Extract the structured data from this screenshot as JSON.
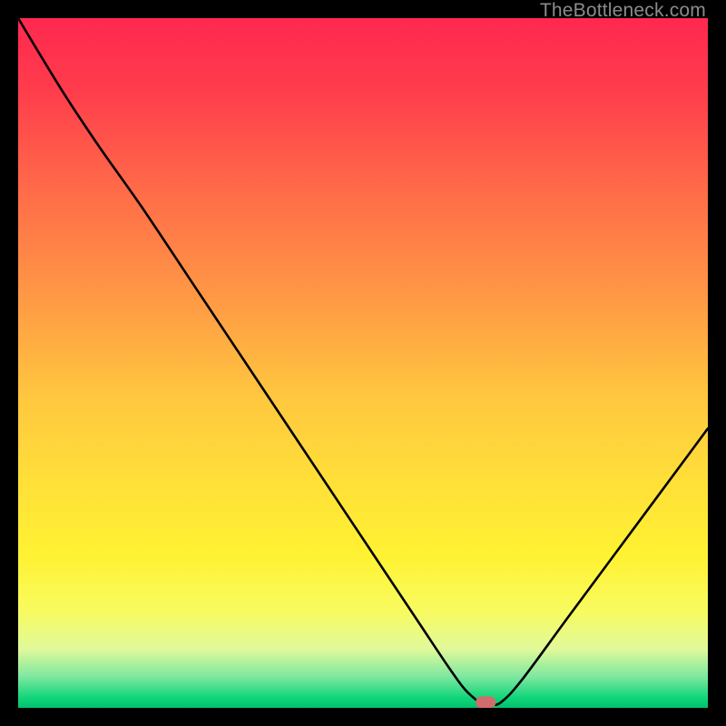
{
  "watermark": "TheBottleneck.com",
  "chart_data": {
    "type": "line",
    "title": "",
    "xlabel": "",
    "ylabel": "",
    "xlim": [
      0,
      100
    ],
    "ylim": [
      0,
      100
    ],
    "grid": false,
    "legend": false,
    "series": [
      {
        "name": "curve",
        "x": [
          0,
          3,
          7,
          12,
          18,
          26,
          34,
          44,
          52,
          58,
          62,
          64.5,
          66,
          67,
          68.5,
          70,
          73,
          80,
          90,
          100
        ],
        "y": [
          100,
          95,
          88.5,
          81,
          72.5,
          60.5,
          48.5,
          33.5,
          21.5,
          12.5,
          6.5,
          3,
          1.5,
          0.8,
          0.5,
          0.8,
          4,
          13.5,
          27,
          40.5
        ]
      }
    ],
    "marker": {
      "x": 67.8,
      "y": 0.8,
      "color": "#d16c6c"
    },
    "gradient_stops": [
      {
        "pct": 0.0,
        "color": "#ff2850"
      },
      {
        "pct": 0.1,
        "color": "#ff3b4c"
      },
      {
        "pct": 0.25,
        "color": "#ff6b49"
      },
      {
        "pct": 0.4,
        "color": "#ff9745"
      },
      {
        "pct": 0.55,
        "color": "#ffc73f"
      },
      {
        "pct": 0.68,
        "color": "#ffe138"
      },
      {
        "pct": 0.78,
        "color": "#fff233"
      },
      {
        "pct": 0.86,
        "color": "#f8fb60"
      },
      {
        "pct": 0.915,
        "color": "#e0f99a"
      },
      {
        "pct": 0.955,
        "color": "#7de8a0"
      },
      {
        "pct": 0.985,
        "color": "#12d67a"
      },
      {
        "pct": 1.0,
        "color": "#00c26e"
      }
    ]
  }
}
